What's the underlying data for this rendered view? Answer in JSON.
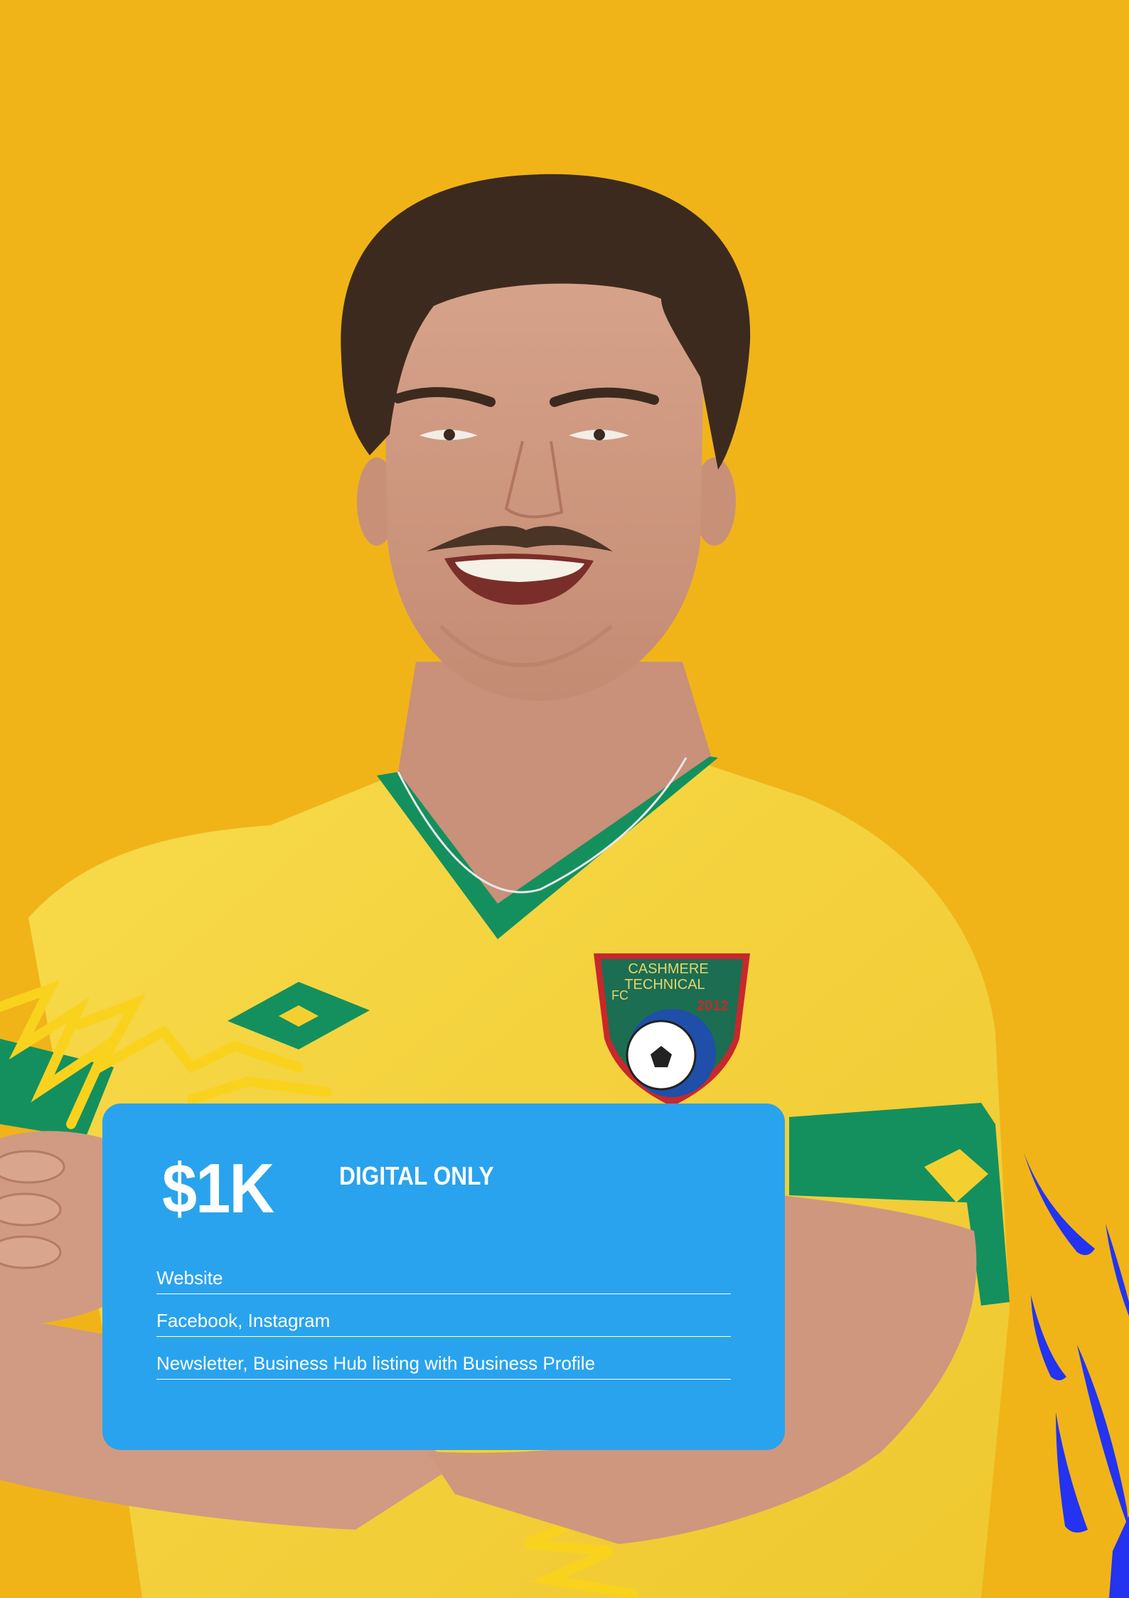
{
  "colors": {
    "background": "#F0B419",
    "card": "#29A3EE",
    "text": "#FFFFFF",
    "jersey": "#F7D23A",
    "trim": "#14905E",
    "accent_blue": "#2333F0"
  },
  "crest": {
    "line1": "CASHMERE",
    "line2": "TECHNICAL",
    "line3": "FC",
    "year": "2012"
  },
  "offer": {
    "price": "$1K",
    "tier": "DIGITAL ONLY",
    "features": [
      "Website",
      "Facebook, Instagram",
      "Newsletter, Business Hub listing with Business Profile"
    ]
  }
}
